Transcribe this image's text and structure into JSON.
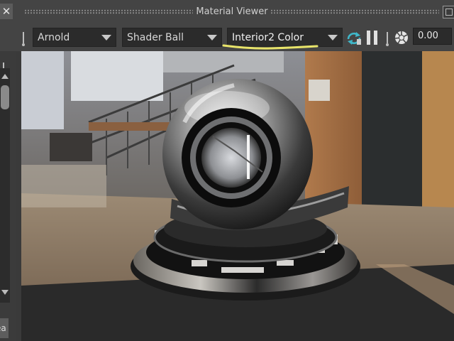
{
  "window": {
    "title": "Material Viewer",
    "close_glyph": "✕"
  },
  "toolbar": {
    "renderer": "Arnold",
    "geometry": "Shader Ball",
    "environment": "Interior2 Color",
    "exposure_value": "0.00",
    "icons": [
      "refresh-render-icon",
      "pause-icon",
      "exposure-aperture-icon"
    ]
  },
  "side_panel": {
    "tab_label": "ea"
  },
  "colors": {
    "panel_bg": "#444444",
    "field_bg": "#2b2b2b",
    "highlight_stroke": "#e8e46a",
    "refresh_icon": "#3fb7c9"
  }
}
